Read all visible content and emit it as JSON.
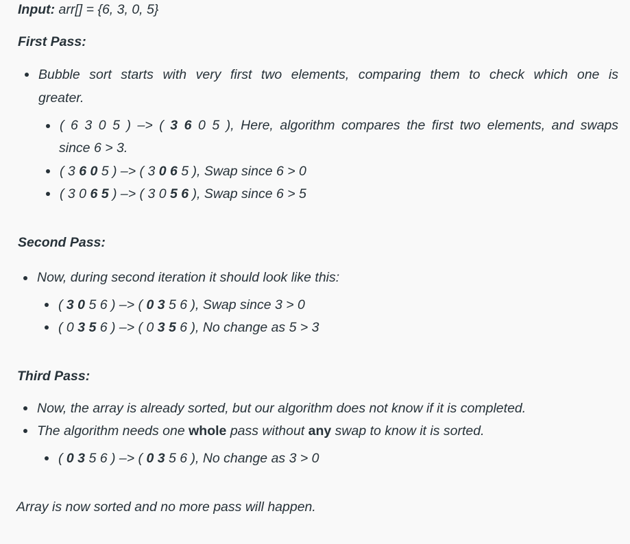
{
  "input": {
    "label": "Input:",
    "value": " arr[] = {6, 3, 0, 5}"
  },
  "first_pass": {
    "heading": "First Pass:",
    "intro_line1": "Bubble sort starts with very first two elements, comparing them to check which one is",
    "intro_line2": "greater.",
    "steps": [
      {
        "before": "( 6 3 0 5 ) –> ( ",
        "b1": "3 6",
        "mid": " 0 5 ), Here, algorithm compares the first two elements, and swaps",
        "cont": "since 6 > 3."
      },
      {
        "pre": "( 3 ",
        "b1": "6 0",
        "mid": " 5 ) –>  ( 3 ",
        "b2": "0 6",
        "post": " 5 ), Swap since 6 > 0"
      },
      {
        "pre": "( 3 0 ",
        "b1": "6 5",
        "mid": " ) –>  ( 3 0 ",
        "b2": "5 6",
        "post": " ), Swap since 6 > 5"
      }
    ]
  },
  "second_pass": {
    "heading": "Second Pass:",
    "intro": "Now, during second iteration it should look like this:",
    "steps": [
      {
        "pre": "( ",
        "b1": "3 0",
        "mid": " 5 6 ) –>  ( ",
        "b2": "0 3",
        "post": " 5 6 ), Swap since 3 > 0"
      },
      {
        "pre": "( 0 ",
        "b1": "3 5",
        "mid": " 6 ) –>  ( 0 ",
        "b2": "3 5",
        "post": " 6 ), No change as 5 > 3"
      }
    ]
  },
  "third_pass": {
    "heading": "Third Pass:",
    "note1": "Now, the array is already sorted, but our algorithm does not know if it is completed.",
    "note2": {
      "a": "The algorithm needs one ",
      "b": "whole",
      "c": " pass without ",
      "d": "any",
      "e": " swap to know it is sorted."
    },
    "steps": [
      {
        "pre": "( ",
        "b1": "0 3",
        "mid": " 5 6 ) –>  ( ",
        "b2": "0 3",
        "post": " 5 6 ), No change as 3 > 0"
      }
    ]
  },
  "conclusion": "Array is now sorted and no more pass will happen."
}
